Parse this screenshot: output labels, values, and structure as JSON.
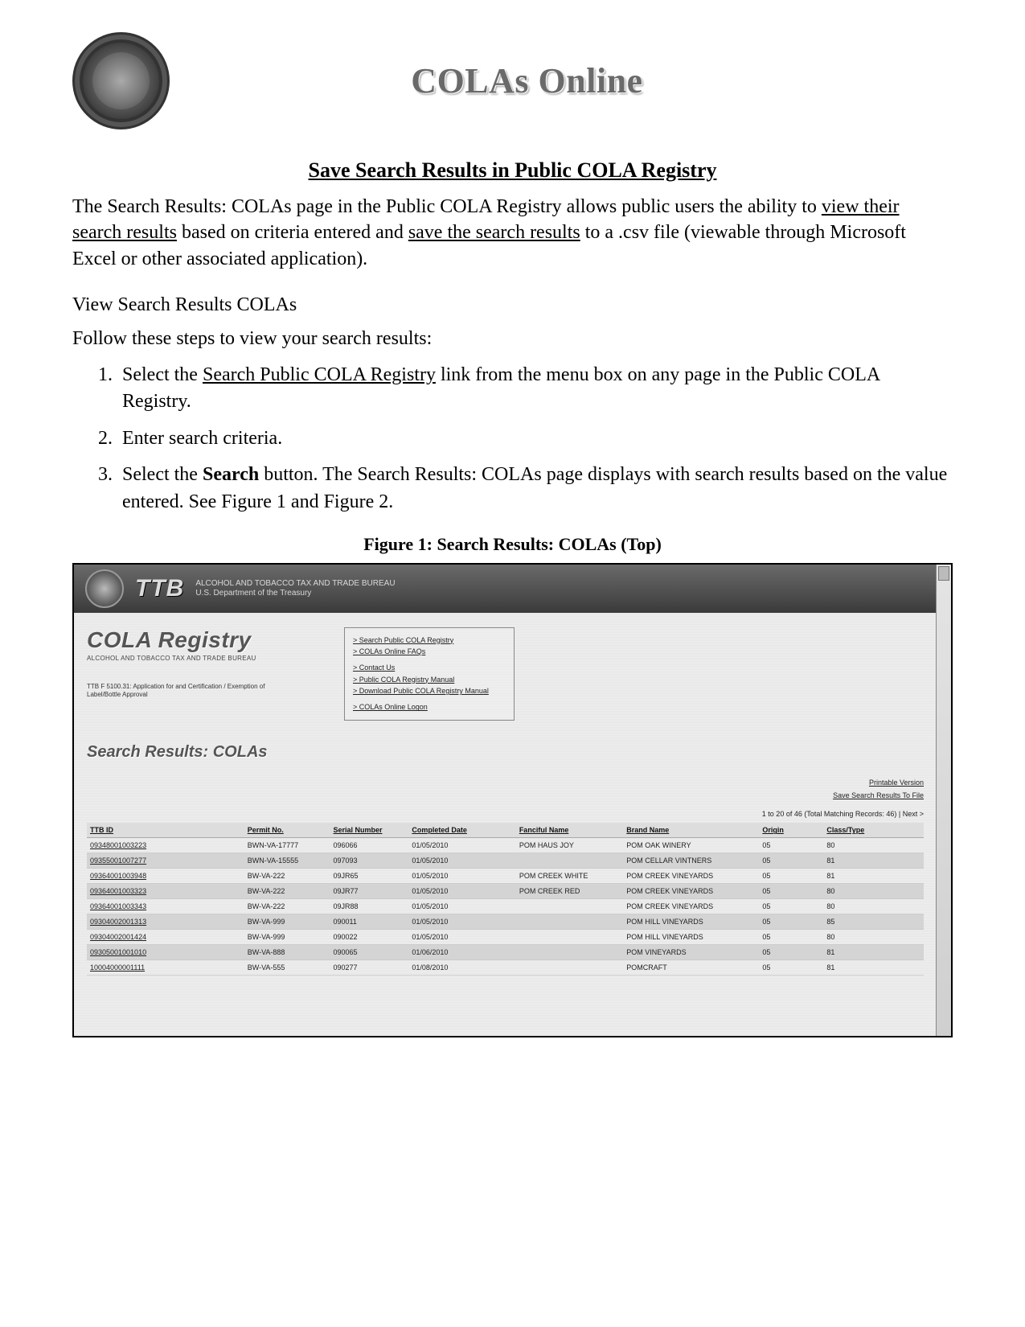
{
  "doc": {
    "app_title": "COLAs Online",
    "sub_title": "Save Search Results in Public COLA Registry",
    "intro_pre": "The Search Results: COLAs page in the Public COLA Registry allows public users the ability to ",
    "intro_link1": "view their search results",
    "intro_mid": " based on criteria entered and ",
    "intro_link2": "save the search results",
    "intro_post": " to a .csv file (viewable through Microsoft Excel or other associated application).",
    "view_heading": "View Search Results COLAs",
    "follow": "Follow these steps to view your search results:",
    "step1_pre": "Select the ",
    "step1_link": "Search Public COLA Registry",
    "step1_post": " link from the menu box on any page in the Public COLA Registry.",
    "step2": "Enter search criteria.",
    "step3_pre": "Select the ",
    "step3_bold": "Search",
    "step3_post": " button.  The Search Results: COLAs page displays with search results based on the value entered.  See Figure 1 and Figure 2.",
    "fig_caption": "Figure 1: Search Results: COLAs (Top)"
  },
  "shot": {
    "ttb": "TTB",
    "bureau_line1": "ALCOHOL AND TOBACCO TAX AND TRADE BUREAU",
    "bureau_line2": "U.S. Department of the Treasury",
    "registry_title": "COLA Registry",
    "registry_sub": "ALCOHOL AND TOBACCO TAX AND TRADE BUREAU",
    "form_note": "TTB F 5100.31: Application for and Certification / Exemption of Label/Bottle Approval",
    "menu": {
      "m1": "> Search Public COLA Registry",
      "m2": "> COLAs Online FAQs",
      "m3": "> Contact Us",
      "m4": "> Public COLA Registry Manual",
      "m5": "> Download Public COLA Registry Manual",
      "m6": "> COLAs Online Logon"
    },
    "results_heading": "Search Results: COLAs",
    "action_links": {
      "printable": "Printable Version",
      "save": "Save Search Results To File"
    },
    "pager": "1 to 20 of 46 (Total Matching Records: 46) | Next >",
    "headers": {
      "id": "TTB ID",
      "permit": "Permit No.",
      "serial": "Serial Number",
      "date": "Completed Date",
      "fanciful": "Fanciful Name",
      "brand": "Brand Name",
      "origin": "Origin",
      "class": "Class/Type"
    },
    "rows": [
      {
        "id": "09348001003223",
        "permit": "BWN-VA-17777",
        "serial": "096066",
        "date": "01/05/2010",
        "fanciful": "POM HAUS JOY",
        "brand": "POM OAK WINERY",
        "origin": "05",
        "class": "80"
      },
      {
        "id": "09355001007277",
        "permit": "BWN-VA-15555",
        "serial": "097093",
        "date": "01/05/2010",
        "fanciful": "",
        "brand": "POM CELLAR VINTNERS",
        "origin": "05",
        "class": "81"
      },
      {
        "id": "09364001003948",
        "permit": "BW-VA-222",
        "serial": "09JR65",
        "date": "01/05/2010",
        "fanciful": "POM CREEK WHITE",
        "brand": "POM CREEK VINEYARDS",
        "origin": "05",
        "class": "81"
      },
      {
        "id": "09364001003323",
        "permit": "BW-VA-222",
        "serial": "09JR77",
        "date": "01/05/2010",
        "fanciful": "POM CREEK RED",
        "brand": "POM CREEK VINEYARDS",
        "origin": "05",
        "class": "80"
      },
      {
        "id": "09364001003343",
        "permit": "BW-VA-222",
        "serial": "09JR88",
        "date": "01/05/2010",
        "fanciful": "",
        "brand": "POM CREEK VINEYARDS",
        "origin": "05",
        "class": "80"
      },
      {
        "id": "09304002001313",
        "permit": "BW-VA-999",
        "serial": "090011",
        "date": "01/05/2010",
        "fanciful": "",
        "brand": "POM HILL VINEYARDS",
        "origin": "05",
        "class": "85"
      },
      {
        "id": "09304002001424",
        "permit": "BW-VA-999",
        "serial": "090022",
        "date": "01/05/2010",
        "fanciful": "",
        "brand": "POM HILL VINEYARDS",
        "origin": "05",
        "class": "80"
      },
      {
        "id": "09305001001010",
        "permit": "BW-VA-888",
        "serial": "090065",
        "date": "01/06/2010",
        "fanciful": "",
        "brand": "POM VINEYARDS",
        "origin": "05",
        "class": "81"
      },
      {
        "id": "10004000001111",
        "permit": "BW-VA-555",
        "serial": "090277",
        "date": "01/08/2010",
        "fanciful": "",
        "brand": "POMCRAFT",
        "origin": "05",
        "class": "81"
      }
    ]
  }
}
